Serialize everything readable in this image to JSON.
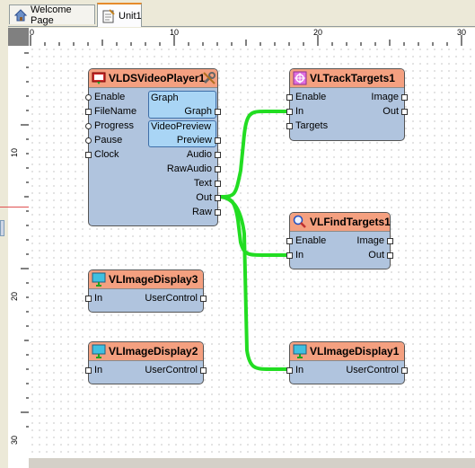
{
  "tabs": [
    {
      "label": "Welcome Page",
      "icon": "home-icon"
    },
    {
      "label": "Unit1",
      "icon": "unit-icon"
    }
  ],
  "ruler": {
    "h_labels": [
      "0",
      "10",
      "20",
      "30"
    ],
    "v_labels": [
      "10",
      "20",
      "30"
    ]
  },
  "components": {
    "player": {
      "title": "VLDSVideoPlayer1",
      "inputs": [
        "Enable",
        "FileName",
        "Progress",
        "Pause",
        "Clock"
      ],
      "graph_box": {
        "title": "Graph",
        "pin": "Graph"
      },
      "preview_box": {
        "title": "VideoPreview",
        "pin": "Preview"
      },
      "outputs": [
        "Audio",
        "RawAudio",
        "Text",
        "Out",
        "Raw"
      ]
    },
    "track": {
      "title": "VLTrackTargets1",
      "inputs": [
        "Enable",
        "In",
        "Targets"
      ],
      "outputs": [
        "Image",
        "Out"
      ]
    },
    "find": {
      "title": "VLFindTargets1",
      "inputs": [
        "Enable",
        "In"
      ],
      "outputs": [
        "Image",
        "Out"
      ]
    },
    "display3": {
      "title": "VLImageDisplay3",
      "inputs": [
        "In"
      ],
      "outputs": [
        "UserControl"
      ]
    },
    "display2": {
      "title": "VLImageDisplay2",
      "inputs": [
        "In"
      ],
      "outputs": [
        "UserControl"
      ]
    },
    "display1": {
      "title": "VLImageDisplay1",
      "inputs": [
        "In"
      ],
      "outputs": [
        "UserControl"
      ]
    }
  },
  "colors": {
    "header": "#f4a080",
    "body": "#b0c4de",
    "wire": "#22dd22",
    "subbox": "#a9d5f5"
  }
}
